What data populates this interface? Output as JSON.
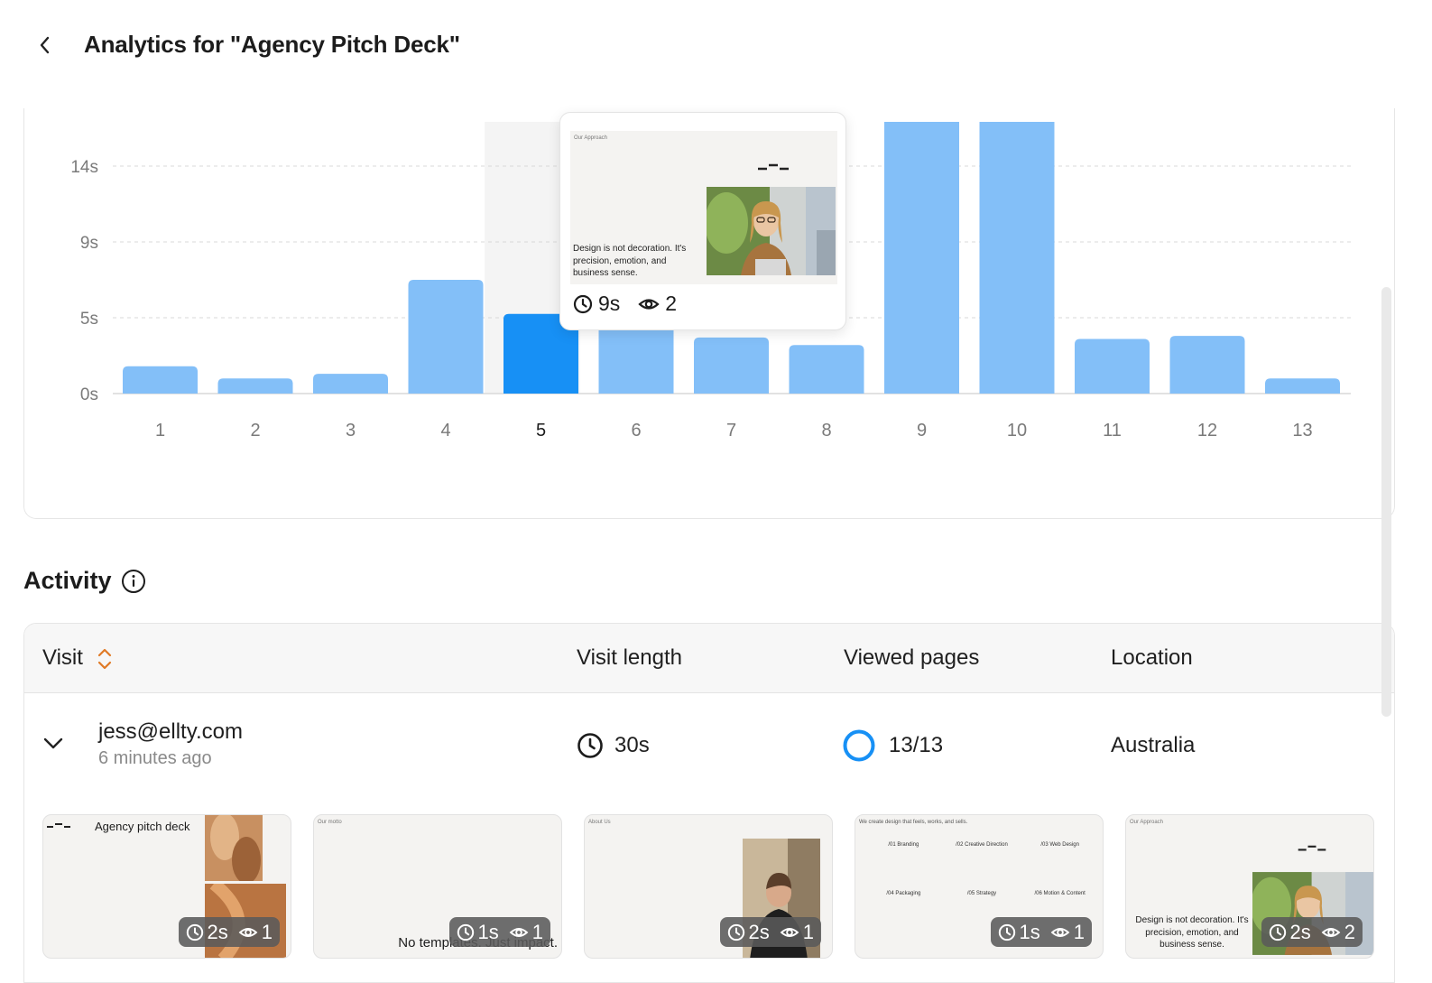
{
  "header": {
    "title": "Analytics for \"Agency Pitch Deck\""
  },
  "chart_data": {
    "type": "bar",
    "categories": [
      "1",
      "2",
      "3",
      "4",
      "5",
      "6",
      "7",
      "8",
      "9",
      "10",
      "11",
      "12",
      "13"
    ],
    "values": [
      1.8,
      1.0,
      1.3,
      7.0,
      5.2,
      5.0,
      3.7,
      3.2,
      24,
      24,
      3.6,
      3.8,
      1.0
    ],
    "y_ticks": [
      "0s",
      "5s",
      "9s",
      "14s"
    ],
    "y_tick_values": [
      0,
      5,
      9,
      14
    ],
    "ylim": [
      0,
      16
    ],
    "selected_index": 4,
    "grid": true,
    "colors": {
      "bar": "#83bff8",
      "selected": "#1790f5"
    }
  },
  "tooltip": {
    "slide_label": "Our Approach",
    "quote": "Design is not decoration. It's precision, emotion, and business sense.",
    "time": "9s",
    "views": "2"
  },
  "activity": {
    "title": "Activity",
    "columns": {
      "visit": "Visit",
      "visit_length": "Visit length",
      "viewed_pages": "Viewed pages",
      "location": "Location"
    },
    "rows": [
      {
        "email": "jess@ellty.com",
        "time_ago": "6 minutes ago",
        "visit_length": "30s",
        "viewed_pages": "13/13",
        "location": "Australia",
        "pages": [
          {
            "slide_title": "Agency pitch deck",
            "time": "2s",
            "views": "1"
          },
          {
            "slide_label": "Our motto",
            "slide_text": "No templates. Just impact.",
            "time": "1s",
            "views": "1"
          },
          {
            "slide_label": "About Us",
            "time": "2s",
            "views": "1"
          },
          {
            "slide_label": "We create design that feels, works, and sells.",
            "services": [
              "/01 Branding",
              "/02 Creative Direction",
              "/03 Web Design",
              "/04 Packaging",
              "/05 Strategy",
              "/06 Motion & Content"
            ],
            "time": "1s",
            "views": "1"
          },
          {
            "slide_label": "Our Approach",
            "quote": "Design is not decoration. It's precision, emotion, and business sense.",
            "time": "2s",
            "views": "2"
          }
        ]
      }
    ]
  }
}
